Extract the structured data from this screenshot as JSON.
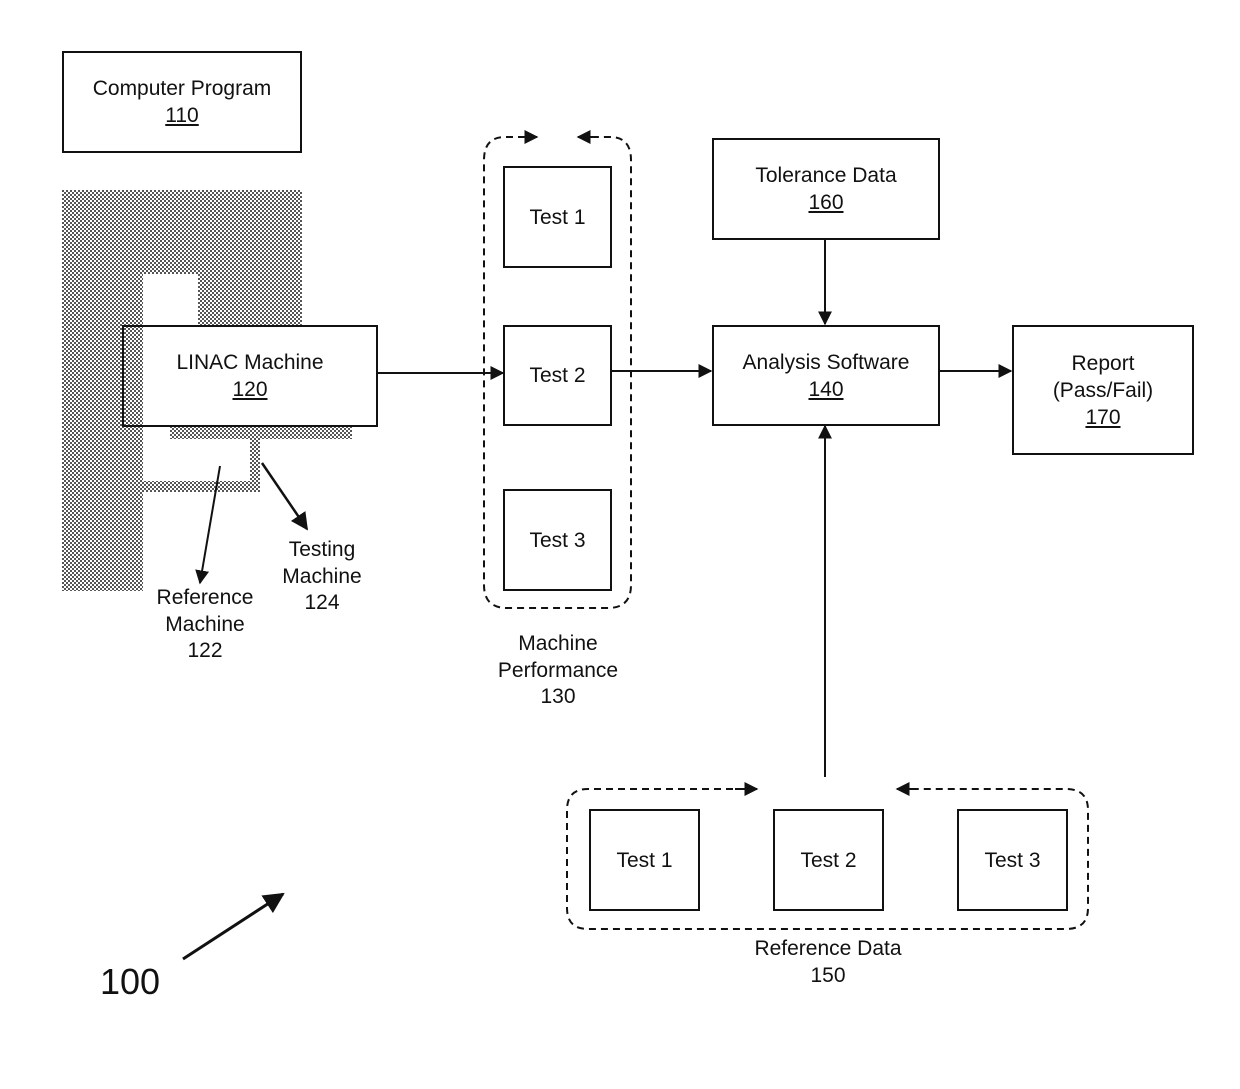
{
  "figure_number": "100",
  "nodes": {
    "computer_program": {
      "title": "Computer Program",
      "ref": "110"
    },
    "linac_machine": {
      "title": "LINAC Machine",
      "ref": "120"
    },
    "reference_machine": {
      "line1": "Reference",
      "line2": "Machine",
      "ref": "122"
    },
    "testing_machine": {
      "line1": "Testing",
      "line2": "Machine",
      "ref": "124"
    },
    "machine_performance": {
      "line1": "Machine",
      "line2": "Performance",
      "ref": "130",
      "tests": [
        "Test 1",
        "Test 2",
        "Test 3"
      ]
    },
    "analysis_software": {
      "title": "Analysis Software",
      "ref": "140"
    },
    "reference_data": {
      "line1": "Reference Data",
      "ref": "150",
      "tests": [
        "Test 1",
        "Test 2",
        "Test 3"
      ]
    },
    "tolerance_data": {
      "title": "Tolerance Data",
      "ref": "160"
    },
    "report": {
      "line1": "Report",
      "line2": "(Pass/Fail)",
      "ref": "170"
    }
  },
  "edges": [
    {
      "from": "LINAC Machine 120",
      "to": "Test 2 (Machine Performance)"
    },
    {
      "from": "Test 2 (Machine Performance)",
      "to": "Analysis Software 140"
    },
    {
      "from": "Tolerance Data 160",
      "to": "Analysis Software 140"
    },
    {
      "from": "Reference Data 150",
      "to": "Analysis Software 140"
    },
    {
      "from": "Analysis Software 140",
      "to": "Report 170"
    }
  ]
}
